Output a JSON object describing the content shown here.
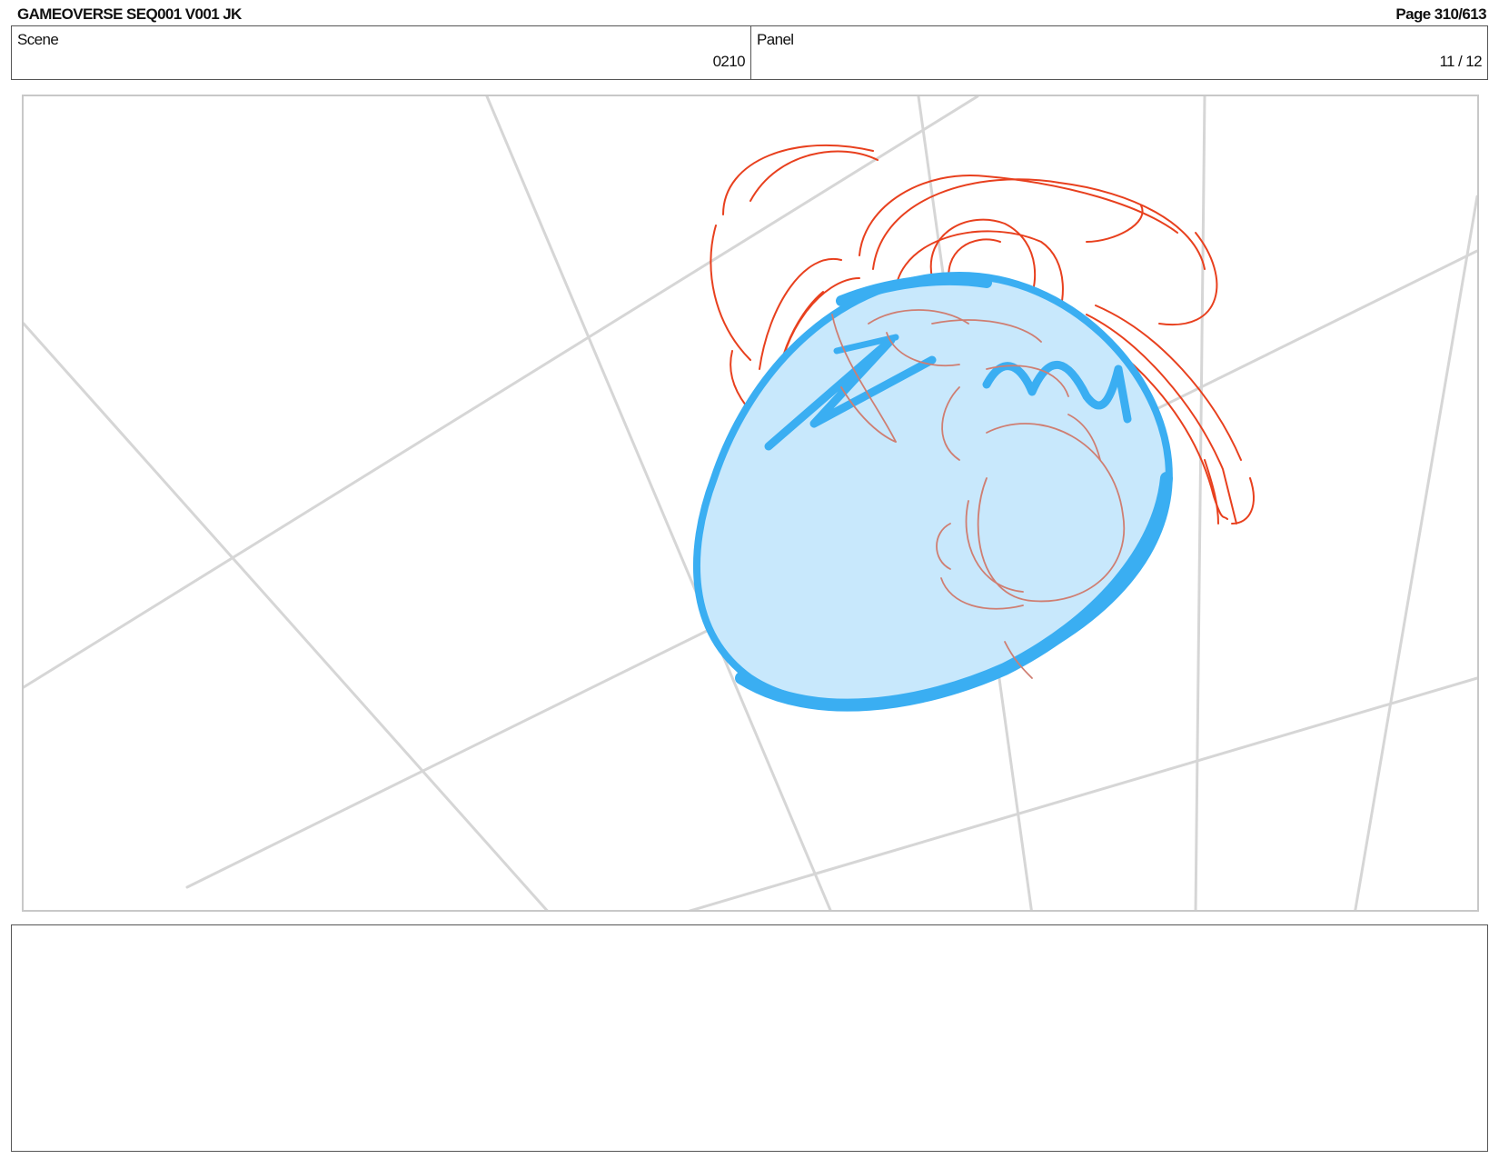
{
  "header": {
    "title": "GAMEOVERSE SEQ001 V001 JK",
    "page": "Page 310/613"
  },
  "info": {
    "scene_label": "Scene",
    "scene_value": "0210",
    "panel_label": "Panel",
    "panel_value": "11 / 12"
  },
  "artwork": {
    "description_colors": {
      "guide_lines": "#d4d4d4",
      "sketch": "#e8401e",
      "figure_lines": "#cf7e72",
      "blob_fill": "#c8e8fc",
      "blob_stroke": "#3aaef2"
    }
  },
  "notes": {
    "text": ""
  }
}
